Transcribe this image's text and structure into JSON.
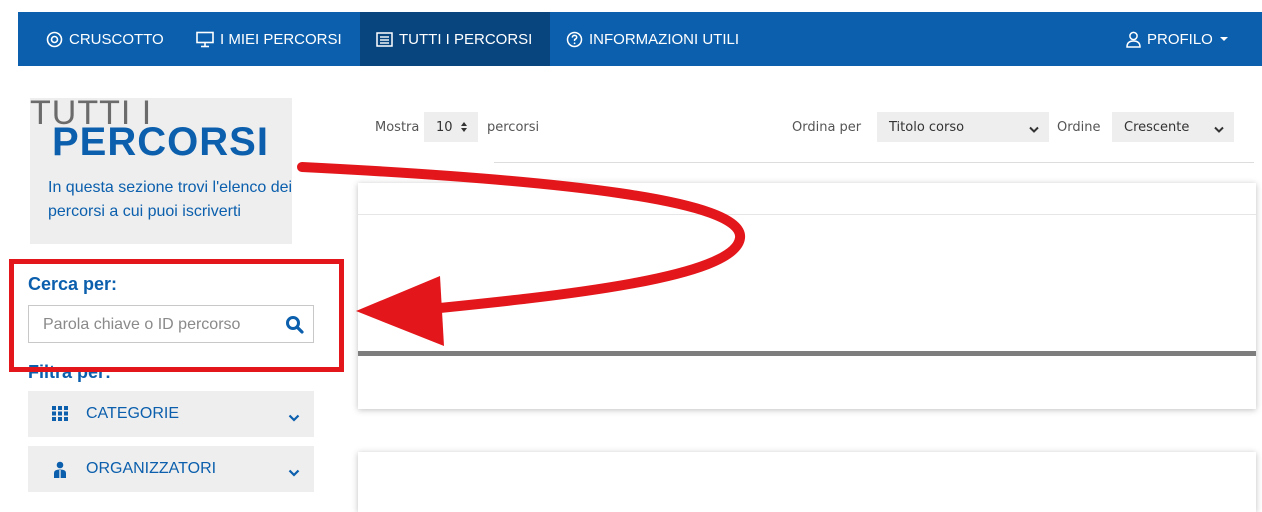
{
  "nav": {
    "items": [
      {
        "label": "CRUSCOTTO",
        "icon": "dashboard-icon"
      },
      {
        "label": "I MIEI PERCORSI",
        "icon": "monitor-icon"
      },
      {
        "label": "TUTTI I PERCORSI",
        "icon": "list-icon",
        "active": true
      },
      {
        "label": "INFORMAZIONI UTILI",
        "icon": "help-circle-icon"
      }
    ],
    "profile": {
      "label": "PROFILO",
      "icon": "user-icon"
    }
  },
  "header": {
    "title_small": "TUTTI I",
    "title_big": "PERCORSI",
    "description": "In questa sezione trovi l'elenco dei percorsi a cui puoi iscriverti"
  },
  "search": {
    "title": "Cerca per:",
    "placeholder": "Parola chiave o ID percorso",
    "value": ""
  },
  "filters": {
    "title": "Filtra per:",
    "items": [
      {
        "label": "CATEGORIE",
        "icon": "grid-icon"
      },
      {
        "label": "ORGANIZZATORI",
        "icon": "users-icon"
      }
    ]
  },
  "toolbar": {
    "show_label": "Mostra",
    "show_value": "10",
    "show_suffix": "percorsi",
    "sort_label": "Ordina per",
    "sort_value": "Titolo corso",
    "order_label": "Ordine",
    "order_value": "Crescente"
  },
  "colors": {
    "brand": "#0b5fad",
    "brand_dark": "#08457f",
    "annotation": "#e3171b"
  }
}
